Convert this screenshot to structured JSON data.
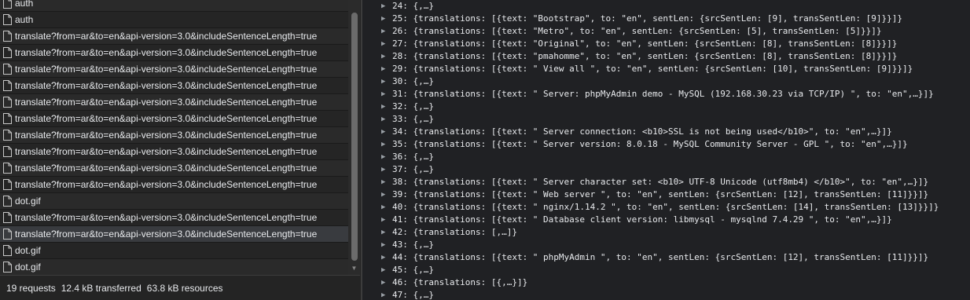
{
  "requests": [
    {
      "name": "auth",
      "selected": false
    },
    {
      "name": "auth",
      "selected": false
    },
    {
      "name": "translate?from=ar&to=en&api-version=3.0&includeSentenceLength=true",
      "selected": false
    },
    {
      "name": "translate?from=ar&to=en&api-version=3.0&includeSentenceLength=true",
      "selected": false
    },
    {
      "name": "translate?from=ar&to=en&api-version=3.0&includeSentenceLength=true",
      "selected": false
    },
    {
      "name": "translate?from=ar&to=en&api-version=3.0&includeSentenceLength=true",
      "selected": false
    },
    {
      "name": "translate?from=ar&to=en&api-version=3.0&includeSentenceLength=true",
      "selected": false
    },
    {
      "name": "translate?from=ar&to=en&api-version=3.0&includeSentenceLength=true",
      "selected": false
    },
    {
      "name": "translate?from=ar&to=en&api-version=3.0&includeSentenceLength=true",
      "selected": false
    },
    {
      "name": "translate?from=ar&to=en&api-version=3.0&includeSentenceLength=true",
      "selected": false
    },
    {
      "name": "translate?from=ar&to=en&api-version=3.0&includeSentenceLength=true",
      "selected": false
    },
    {
      "name": "translate?from=ar&to=en&api-version=3.0&includeSentenceLength=true",
      "selected": false
    },
    {
      "name": "dot.gif",
      "selected": false
    },
    {
      "name": "translate?from=ar&to=en&api-version=3.0&includeSentenceLength=true",
      "selected": false
    },
    {
      "name": "translate?from=ar&to=en&api-version=3.0&includeSentenceLength=true",
      "selected": true
    },
    {
      "name": "dot.gif",
      "selected": false
    },
    {
      "name": "dot.gif",
      "selected": false
    }
  ],
  "status": {
    "requests": "19 requests",
    "transferred": "12.4 kB transferred",
    "resources": "63.8 kB resources"
  },
  "preview_lines": [
    "24: {,…}",
    "25: {translations: [{text: \"Bootstrap\", to: \"en\", sentLen: {srcSentLen: [9], transSentLen: [9]}}]}",
    "26: {translations: [{text: \"Metro\", to: \"en\", sentLen: {srcSentLen: [5], transSentLen: [5]}}]}",
    "27: {translations: [{text: \"Original\", to: \"en\", sentLen: {srcSentLen: [8], transSentLen: [8]}}]}",
    "28: {translations: [{text: \"pmahomme\", to: \"en\", sentLen: {srcSentLen: [8], transSentLen: [8]}}]}",
    "29: {translations: [{text: \" View all \", to: \"en\", sentLen: {srcSentLen: [10], transSentLen: [9]}}]}",
    "30: {,…}",
    "31: {translations: [{text: \" Server: phpMyAdmin demo - MySQL (192.168.30.23 via TCP/IP) \", to: \"en\",…}]}",
    "32: {,…}",
    "33: {,…}",
    "34: {translations: [{text: \" Server connection: <b10>SSL is not being used</b10>\", to: \"en\",…}]}",
    "35: {translations: [{text: \" Server version: 8.0.18 - MySQL Community Server - GPL \", to: \"en\",…}]}",
    "36: {,…}",
    "37: {,…}",
    "38: {translations: [{text: \" Server character set: <b10> UTF-8 Unicode (utf8mb4) </b10>\", to: \"en\",…}]}",
    "39: {translations: [{text: \" Web server \", to: \"en\", sentLen: {srcSentLen: [12], transSentLen: [11]}}]}",
    "40: {translations: [{text: \" nginx/1.14.2 \", to: \"en\", sentLen: {srcSentLen: [14], transSentLen: [13]}}]}",
    "41: {translations: [{text: \" Database client version: libmysql - mysqlnd 7.4.29 \", to: \"en\",…}]}",
    "42: {translations: [,…]}",
    "43: {,…}",
    "44: {translations: [{text: \" phpMyAdmin \", to: \"en\", sentLen: {srcSentLen: [12], transSentLen: [11]}}]}",
    "45: {,…}",
    "46: {translations: [{,…}]}",
    "47: {,…}"
  ],
  "icons": {
    "file": "file-icon",
    "expand": "expand-triangle-icon"
  },
  "colors": {
    "background": "#202124",
    "text": "#e8eaed",
    "selected_row": "#393b3f"
  }
}
